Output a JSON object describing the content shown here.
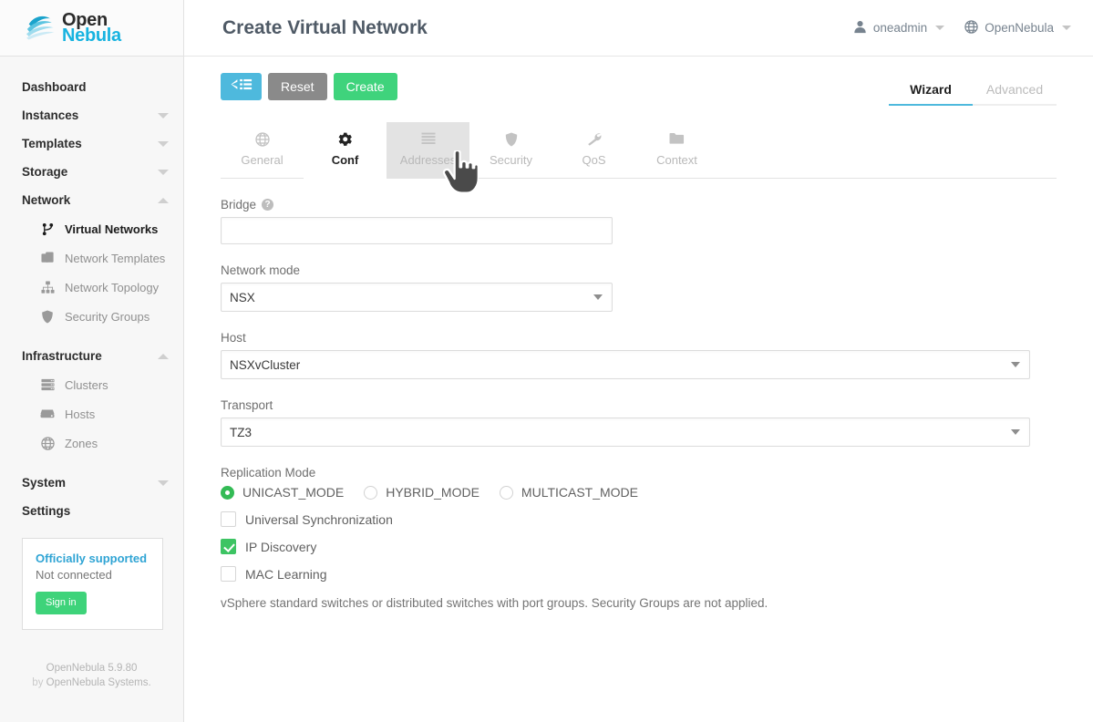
{
  "brand": {
    "logo_open": "Open",
    "logo_nebula": "Nebula",
    "accent_cyan": "#17b3e0",
    "accent_green": "#3fd37c"
  },
  "sidebar": {
    "groups": [
      {
        "label": "Dashboard",
        "caret": null
      },
      {
        "label": "Instances",
        "caret": "down"
      },
      {
        "label": "Templates",
        "caret": "down"
      },
      {
        "label": "Storage",
        "caret": "down"
      },
      {
        "label": "Network",
        "caret": "up"
      }
    ],
    "network_items": [
      {
        "label": "Virtual Networks",
        "icon": "network-branch-icon",
        "active": true
      },
      {
        "label": "Network Templates",
        "icon": "copy-icon",
        "active": false
      },
      {
        "label": "Network Topology",
        "icon": "sitemap-icon",
        "active": false
      },
      {
        "label": "Security Groups",
        "icon": "shield-icon",
        "active": false
      }
    ],
    "infrastructure": {
      "label": "Infrastructure",
      "caret": "up"
    },
    "infrastructure_items": [
      {
        "label": "Clusters",
        "icon": "server-icon"
      },
      {
        "label": "Hosts",
        "icon": "hdd-icon"
      },
      {
        "label": "Zones",
        "icon": "globe-icon"
      }
    ],
    "system": {
      "label": "System",
      "caret": "down"
    },
    "settings": {
      "label": "Settings",
      "caret": null
    },
    "support": {
      "title": "Officially supported",
      "status": "Not connected",
      "button": "Sign in"
    },
    "footer": {
      "version": "OpenNebula 5.9.80",
      "by": "by ",
      "company": "OpenNebula Systems."
    }
  },
  "header": {
    "title": "Create Virtual Network",
    "user": "oneadmin",
    "user_icon": "user-icon",
    "zone": "OpenNebula",
    "zone_icon": "globe-icon"
  },
  "toolbar": {
    "back_icon": "arrow-left-list-icon",
    "reset_label": "Reset",
    "create_label": "Create"
  },
  "wizard_tabs": [
    {
      "label": "Wizard",
      "active": true
    },
    {
      "label": "Advanced",
      "active": false
    }
  ],
  "form_tabs": [
    {
      "label": "General",
      "icon": "globe-icon",
      "active": false,
      "hover": false
    },
    {
      "label": "Conf",
      "icon": "gear-icon",
      "active": true,
      "hover": false
    },
    {
      "label": "Addresses",
      "icon": "list-icon",
      "active": false,
      "hover": true
    },
    {
      "label": "Security",
      "icon": "shield-icon",
      "active": false,
      "hover": false
    },
    {
      "label": "QoS",
      "icon": "wrench-icon",
      "active": false,
      "hover": false
    },
    {
      "label": "Context",
      "icon": "folder-icon",
      "active": false,
      "hover": false
    }
  ],
  "form": {
    "bridge": {
      "label": "Bridge",
      "help_icon": "question-circle-icon",
      "value": "",
      "placeholder": ""
    },
    "network_mode": {
      "label": "Network mode",
      "value": "NSX"
    },
    "host": {
      "label": "Host",
      "value": "NSXvCluster"
    },
    "transport": {
      "label": "Transport",
      "value": "TZ3"
    },
    "replication_mode": {
      "label": "Replication Mode",
      "options": [
        {
          "label": "UNICAST_MODE",
          "checked": true
        },
        {
          "label": "HYBRID_MODE",
          "checked": false
        },
        {
          "label": "MULTICAST_MODE",
          "checked": false
        }
      ]
    },
    "checkboxes": [
      {
        "label": "Universal Synchronization",
        "checked": false
      },
      {
        "label": "IP Discovery",
        "checked": true
      },
      {
        "label": "MAC Learning",
        "checked": false
      }
    ],
    "hint": "vSphere standard switches or distributed switches with port groups. Security Groups are not applied."
  },
  "cursor": {
    "type": "pointing-hand-cursor"
  }
}
